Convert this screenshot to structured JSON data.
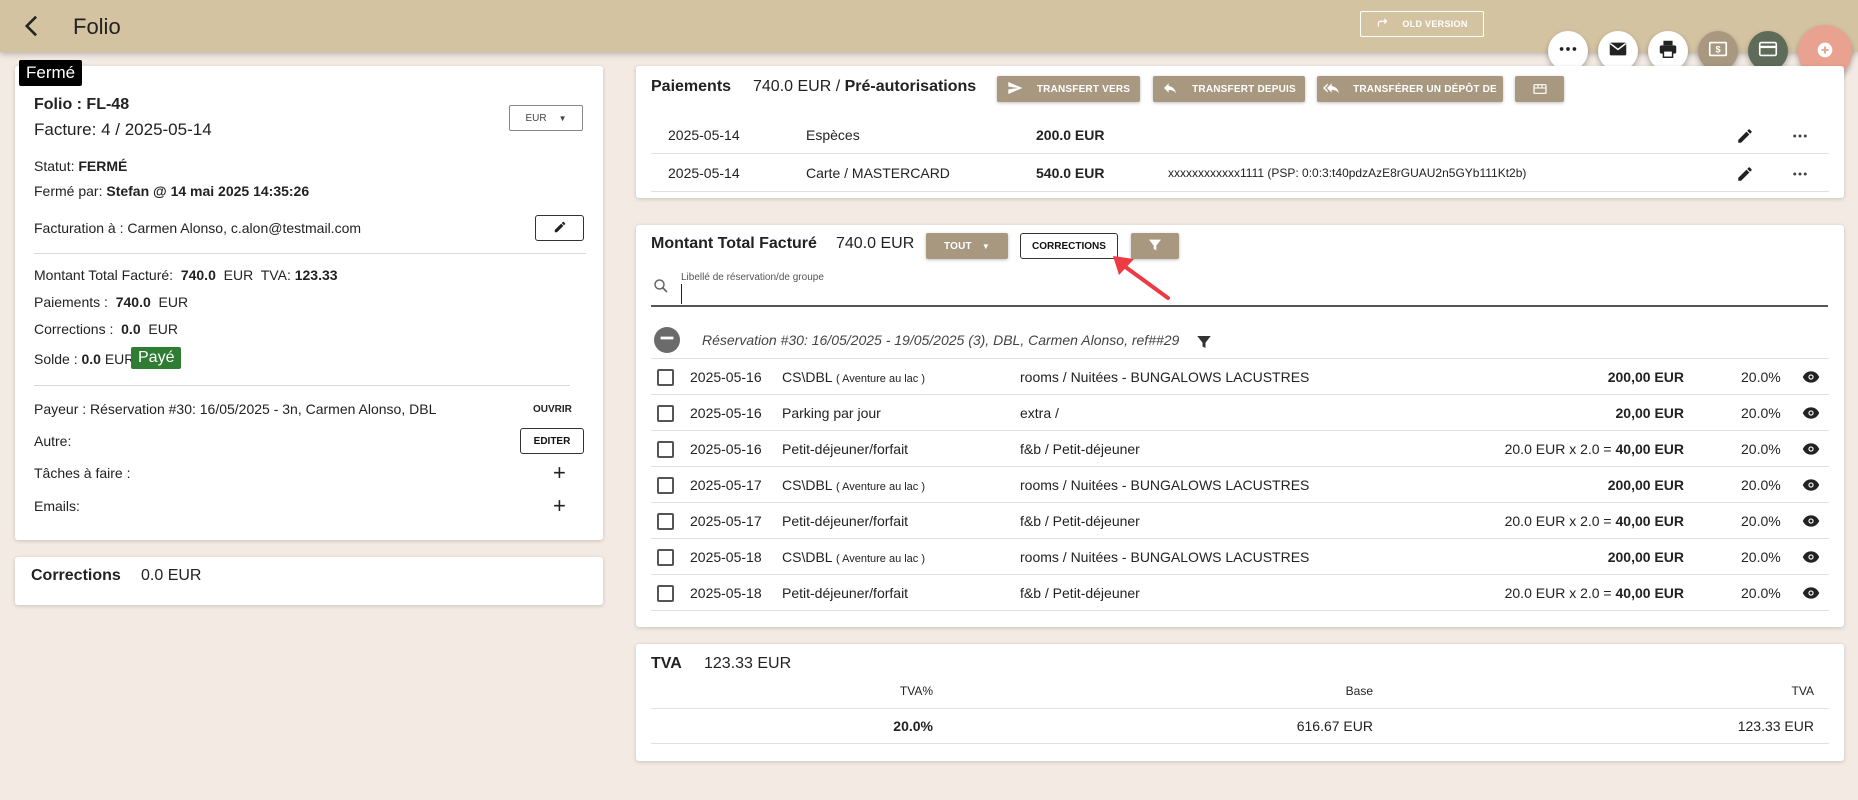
{
  "header": {
    "title": "Folio",
    "old_version_label": "OLD VERSION"
  },
  "folio": {
    "status_chip": "Fermé",
    "folio_label": "Folio : FL-48",
    "invoice_label": "Facture: 4 / 2025-05-14",
    "currency": "EUR",
    "status_prefix": "Statut:",
    "status_value": "FERMÉ",
    "closed_by_prefix": "Fermé par:",
    "closed_by_value": "Stefan @ 14 mai 2025 14:35:26",
    "billing_to": "Facturation à : Carmen Alonso, c.alon@testmail.com",
    "total_label": "Montant Total Facturé:",
    "total_value": "740.0",
    "total_currency": "EUR",
    "tva_label": "TVA:",
    "tva_value": "123.33",
    "payments_label": "Paiements :",
    "payments_value": "740.0",
    "payments_currency": "EUR",
    "corrections_label": "Corrections :",
    "corrections_value": "0.0",
    "corrections_currency": "EUR",
    "balance_label": "Solde :",
    "balance_value": "0.0",
    "balance_currency": "EUR",
    "paid_badge": "Payé",
    "payer": "Payeur : Réservation #30: 16/05/2025 - 3n, Carmen Alonso, DBL",
    "open_button": "OUVRIR",
    "other_label": "Autre:",
    "edit_button": "EDITER",
    "tasks_label": "Tâches à faire :",
    "emails_label": "Emails:"
  },
  "corrections_card": {
    "title": "Corrections",
    "amount": "0.0 EUR"
  },
  "payments": {
    "title": "Paiements",
    "amount": "740.0 EUR /",
    "preauth": "Pré-autorisations",
    "btn_transfer_to": "TRANSFERT VERS",
    "btn_transfer_from": "TRANSFERT DEPUIS",
    "btn_transfer_deposit": "TRANSFÉRER UN DÉPÔT DE",
    "rows": [
      {
        "date": "2025-05-14",
        "method": "Espèces",
        "amount": "200.0 EUR",
        "detail": ""
      },
      {
        "date": "2025-05-14",
        "method": "Carte / MASTERCARD",
        "amount": "540.0 EUR",
        "detail": "xxxxxxxxxxxx1111 (PSP: 0:0:3:t40pdzAzE8rGUAU2n5GYb111Kt2b)"
      }
    ]
  },
  "billed": {
    "title": "Montant Total Facturé",
    "amount": "740.0 EUR",
    "filter_all": "TOUT",
    "corrections_button": "CORRECTIONS",
    "search_placeholder": "Libellé de réservation/de groupe",
    "reservation": "Réservation #30: 16/05/2025 - 19/05/2025 (3), DBL, Carmen Alonso, ref##29",
    "items": [
      {
        "date": "2025-05-16",
        "label": "CS\\DBL",
        "sub": "( Aventure au lac )",
        "category": "rooms / Nuitées - BUNGALOWS LACUSTRES",
        "calc": "",
        "amount": "200,00 EUR",
        "vat": "20.0%"
      },
      {
        "date": "2025-05-16",
        "label": "Parking par jour",
        "sub": "",
        "category": "extra /",
        "calc": "",
        "amount": "20,00 EUR",
        "vat": "20.0%"
      },
      {
        "date": "2025-05-16",
        "label": "Petit-déjeuner/forfait",
        "sub": "",
        "category": "f&b / Petit-déjeuner",
        "calc": "20.0 EUR x 2.0 =",
        "amount": "40,00 EUR",
        "vat": "20.0%"
      },
      {
        "date": "2025-05-17",
        "label": "CS\\DBL",
        "sub": "( Aventure au lac )",
        "category": "rooms / Nuitées - BUNGALOWS LACUSTRES",
        "calc": "",
        "amount": "200,00 EUR",
        "vat": "20.0%"
      },
      {
        "date": "2025-05-17",
        "label": "Petit-déjeuner/forfait",
        "sub": "",
        "category": "f&b / Petit-déjeuner",
        "calc": "20.0 EUR x 2.0 =",
        "amount": "40,00 EUR",
        "vat": "20.0%"
      },
      {
        "date": "2025-05-18",
        "label": "CS\\DBL",
        "sub": "( Aventure au lac )",
        "category": "rooms / Nuitées - BUNGALOWS LACUSTRES",
        "calc": "",
        "amount": "200,00 EUR",
        "vat": "20.0%"
      },
      {
        "date": "2025-05-18",
        "label": "Petit-déjeuner/forfait",
        "sub": "",
        "category": "f&b / Petit-déjeuner",
        "calc": "20.0 EUR x 2.0 =",
        "amount": "40,00 EUR",
        "vat": "20.0%"
      }
    ]
  },
  "tva": {
    "title": "TVA",
    "amount": "123.33 EUR",
    "col_rate": "TVA%",
    "col_base": "Base",
    "col_tva": "TVA",
    "rate": "20.0%",
    "base": "616.67 EUR",
    "value": "123.33 EUR"
  },
  "colors": {
    "topbar": "#d4c3a1",
    "background": "#f3ebe3",
    "tan_button": "#a8987f",
    "paid_green": "#2e7d32",
    "fab_add": "#e8a28f"
  },
  "icons": [
    "back-arrow-icon",
    "redo-icon",
    "more-horizontal-icon",
    "mail-icon",
    "print-icon",
    "money-icon",
    "credit-card-icon",
    "add-circle-icon",
    "send-icon",
    "reply-icon",
    "reply-all-icon",
    "gift-icon",
    "pencil-icon",
    "search-icon",
    "filter-icon",
    "eye-icon",
    "minus-circle-icon",
    "chevron-down-icon"
  ]
}
